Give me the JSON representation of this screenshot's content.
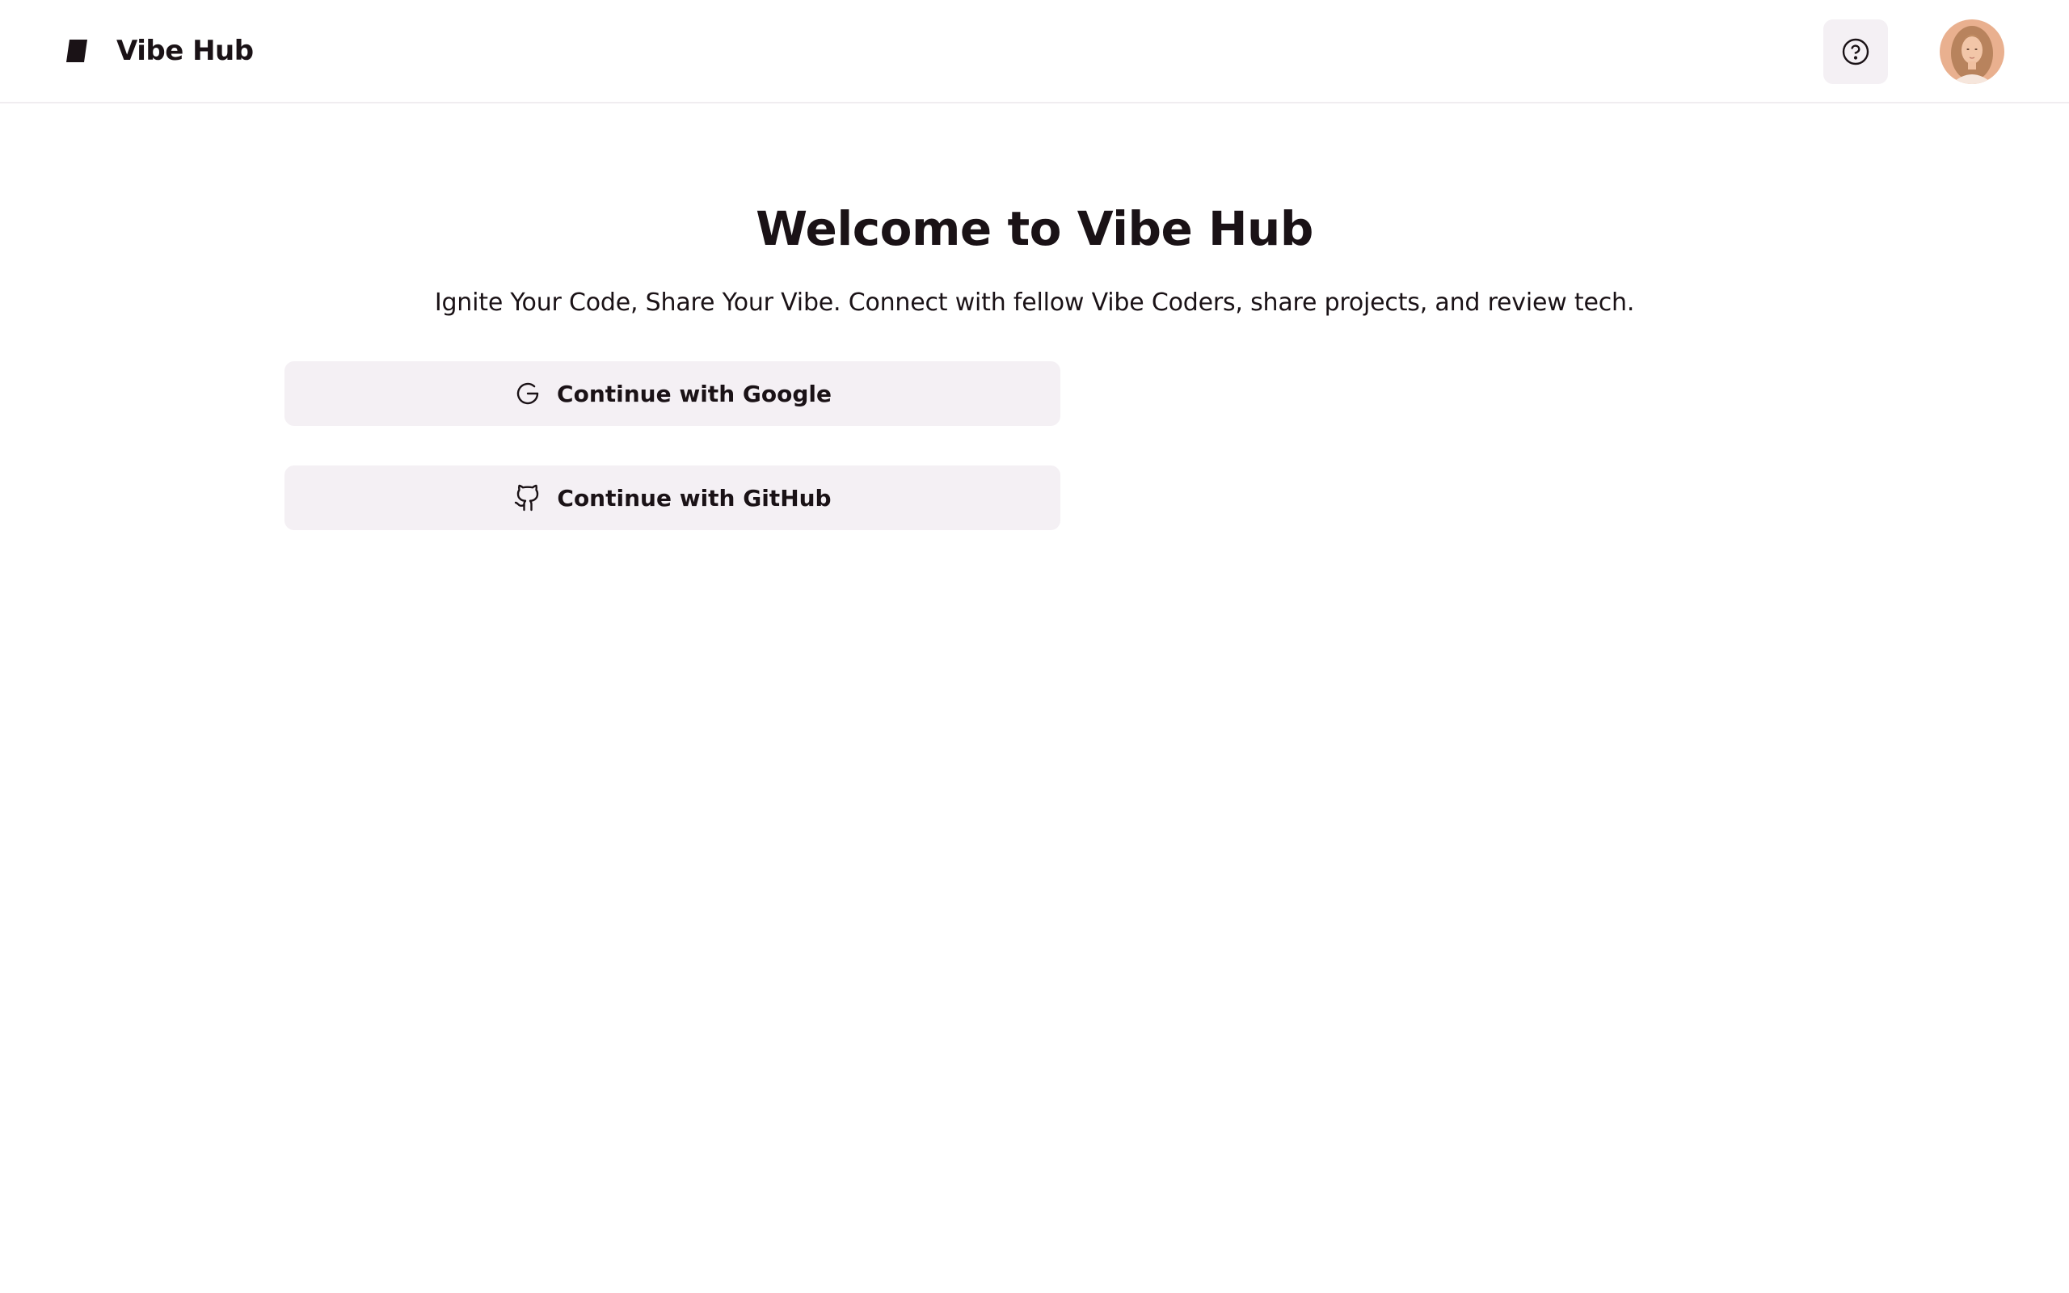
{
  "header": {
    "brand_name": "Vibe Hub",
    "logo_icon": "vibe-hub-logo-icon",
    "help_icon": "help-circle-icon",
    "avatar_icon": "user-avatar"
  },
  "main": {
    "title": "Welcome to Vibe Hub",
    "subtitle": "Ignite Your Code, Share Your Vibe. Connect with fellow Vibe Coders, share projects, and review tech.",
    "buttons": [
      {
        "label": "Continue with Google",
        "icon": "google-icon"
      },
      {
        "label": "Continue with GitHub",
        "icon": "github-icon"
      }
    ]
  },
  "colors": {
    "text": "#1a1216",
    "button_bg": "#f4f0f4",
    "header_border": "#f0edf0",
    "background": "#ffffff"
  }
}
